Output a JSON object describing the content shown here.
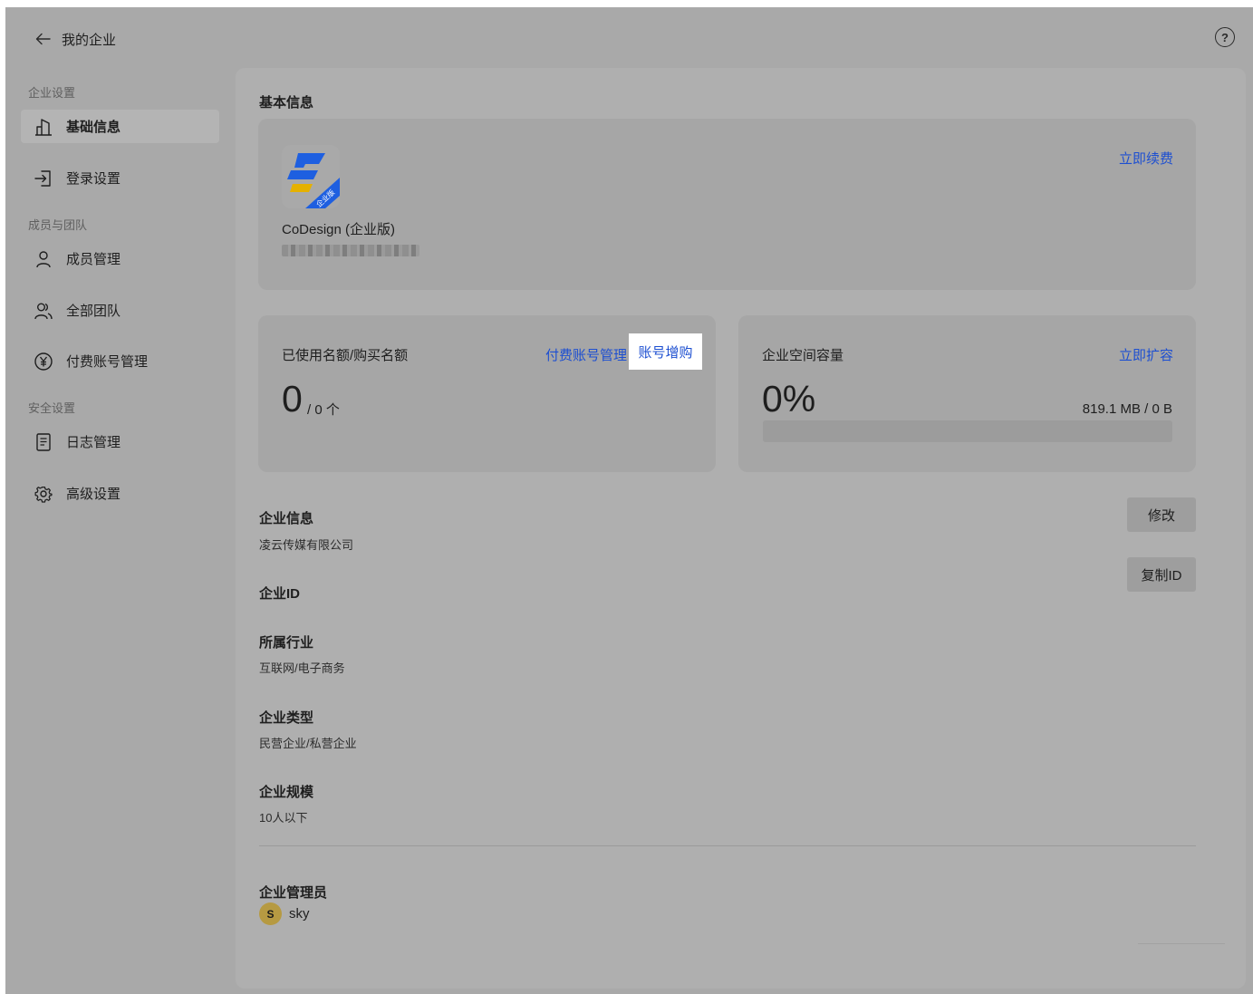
{
  "header": {
    "back_label": "我的企业",
    "help_label": "?"
  },
  "sidebar": {
    "section_enterprise": "企业设置",
    "section_members": "成员与团队",
    "section_security": "安全设置",
    "items": [
      {
        "label": "基础信息",
        "icon": "building-icon",
        "active": true
      },
      {
        "label": "登录设置",
        "icon": "login-icon"
      },
      {
        "label": "成员管理",
        "icon": "user-icon"
      },
      {
        "label": "全部团队",
        "icon": "team-icon"
      },
      {
        "label": "付费账号管理",
        "icon": "yen-icon"
      },
      {
        "label": "日志管理",
        "icon": "log-icon"
      },
      {
        "label": "高级设置",
        "icon": "gear-icon"
      }
    ]
  },
  "main": {
    "title": "基本信息",
    "product": {
      "name": "CoDesign (企业版)",
      "badge": "企业版",
      "renew_link": "立即续费"
    },
    "seats": {
      "label": "已使用名额/购买名额",
      "used": "0",
      "total": "/ 0 个",
      "manage_link": "付费账号管理",
      "buy_link": "账号增购"
    },
    "storage": {
      "label": "企业空间容量",
      "expand_link": "立即扩容",
      "percent": "0%",
      "usage": "819.1 MB / 0 B",
      "fill_fraction": 0
    },
    "company_info": {
      "title": "企业信息",
      "value": "凌云传媒有限公司",
      "edit_button": "修改"
    },
    "company_id": {
      "title": "企业ID",
      "copy_button": "复制ID"
    },
    "industry": {
      "title": "所属行业",
      "value": "互联网/电子商务"
    },
    "company_type": {
      "title": "企业类型",
      "value": "民营企业/私营企业"
    },
    "company_scale": {
      "title": "企业规模",
      "value": "10人以下"
    },
    "admin": {
      "title": "企业管理员",
      "avatar_letter": "S",
      "name": "sky"
    }
  },
  "colors": {
    "link": "#1d4fd1",
    "avatar": "#b69a42",
    "logo_blue": "#1e5fe0",
    "logo_yellow": "#e5b100"
  }
}
